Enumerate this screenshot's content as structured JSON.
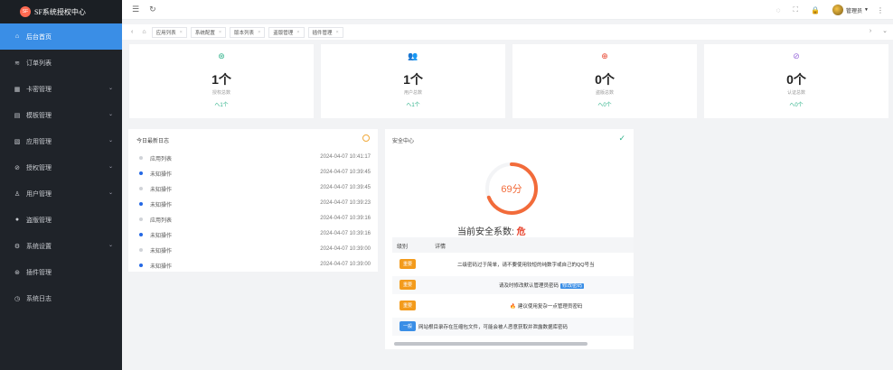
{
  "app": {
    "logo_text": "SF",
    "title": "SF系统授权中心"
  },
  "sidebar": {
    "items": [
      {
        "label": "后台首页",
        "icon": "⌂",
        "has_arrow": false,
        "active": true,
        "name": "sidebar-item-home"
      },
      {
        "label": "订单列表",
        "icon": "≋",
        "has_arrow": false,
        "active": false,
        "name": "sidebar-item-orders"
      },
      {
        "label": "卡密管理",
        "icon": "▦",
        "has_arrow": true,
        "active": false,
        "name": "sidebar-item-cards"
      },
      {
        "label": "模板管理",
        "icon": "▤",
        "has_arrow": true,
        "active": false,
        "name": "sidebar-item-templates"
      },
      {
        "label": "应用管理",
        "icon": "▧",
        "has_arrow": true,
        "active": false,
        "name": "sidebar-item-apps"
      },
      {
        "label": "授权管理",
        "icon": "⊘",
        "has_arrow": true,
        "active": false,
        "name": "sidebar-item-auth"
      },
      {
        "label": "用户管理",
        "icon": "♙",
        "has_arrow": true,
        "active": false,
        "name": "sidebar-item-users"
      },
      {
        "label": "盗版管理",
        "icon": "●",
        "has_arrow": false,
        "active": false,
        "name": "sidebar-item-piracy"
      },
      {
        "label": "系统设置",
        "icon": "⚙",
        "has_arrow": true,
        "active": false,
        "name": "sidebar-item-settings"
      },
      {
        "label": "插件管理",
        "icon": "⊛",
        "has_arrow": false,
        "active": false,
        "name": "sidebar-item-plugins"
      },
      {
        "label": "系统日志",
        "icon": "◷",
        "has_arrow": false,
        "active": false,
        "name": "sidebar-item-logs"
      }
    ]
  },
  "header": {
    "menu_icon": "☰",
    "refresh_icon": "↻",
    "right_icons": [
      "◌",
      "⛶",
      "🔒"
    ],
    "user": "管理员",
    "caret": "▼",
    "more": "⋮"
  },
  "tabs": {
    "prev": "‹",
    "home_icon": "⌂",
    "items": [
      "应用列表",
      "系统配置",
      "版本列表",
      "盗版管理",
      "插件管理"
    ],
    "close": "×",
    "next": "›",
    "dropdown": "⌄"
  },
  "stats": [
    {
      "icon": "⊛",
      "color": "#2fb28a",
      "value": "1个",
      "label": "授权总数",
      "trend": "へ1个"
    },
    {
      "icon": "👥",
      "color": "#3a8ee6",
      "value": "1个",
      "label": "用户总数",
      "trend": "へ1个"
    },
    {
      "icon": "⊕",
      "color": "#e8452f",
      "value": "0个",
      "label": "盗版总数",
      "trend": "へ0个"
    },
    {
      "icon": "⊘",
      "color": "#9b6ddb",
      "value": "0个",
      "label": "认证总数",
      "trend": "へ0个"
    }
  ],
  "log": {
    "title": "今日最新日志",
    "rows": [
      {
        "name": "应用列表",
        "time": "2024-04-07 10:41:17",
        "blue": false
      },
      {
        "name": "未知操作",
        "time": "2024-04-07 10:39:45",
        "blue": true
      },
      {
        "name": "未知操作",
        "time": "2024-04-07 10:39:45",
        "blue": false
      },
      {
        "name": "未知操作",
        "time": "2024-04-07 10:39:23",
        "blue": true
      },
      {
        "name": "应用列表",
        "time": "2024-04-07 10:39:16",
        "blue": false
      },
      {
        "name": "未知操作",
        "time": "2024-04-07 10:39:16",
        "blue": true
      },
      {
        "name": "未知操作",
        "time": "2024-04-07 10:39:00",
        "blue": false
      },
      {
        "name": "未知操作",
        "time": "2024-04-07 10:39:00",
        "blue": true
      }
    ]
  },
  "security": {
    "title": "安全中心",
    "check_icon": "✓",
    "score": 69,
    "score_text": "69分",
    "score_label": "当前安全系数:",
    "score_level": "危",
    "col_level": "级别",
    "col_detail": "详情",
    "rows": [
      {
        "level": "重要",
        "level_color": "orange",
        "detail": "二级密码过于简单，请不要使用较短的纯数字或自己的QQ号当",
        "button": "",
        "flame": false
      },
      {
        "level": "重要",
        "level_color": "orange",
        "detail": "请及时修改默认管理员密码",
        "button": "修改密码",
        "flame": false
      },
      {
        "level": "重要",
        "level_color": "orange",
        "detail": "建议使用复杂一点管理员密码",
        "button": "",
        "flame": true
      },
      {
        "level": "一般",
        "level_color": "blue",
        "detail": "网站根目录存在压缩包文件，可能会被人恶意获取并泄露数据库密码",
        "button": "",
        "flame": false
      }
    ]
  }
}
